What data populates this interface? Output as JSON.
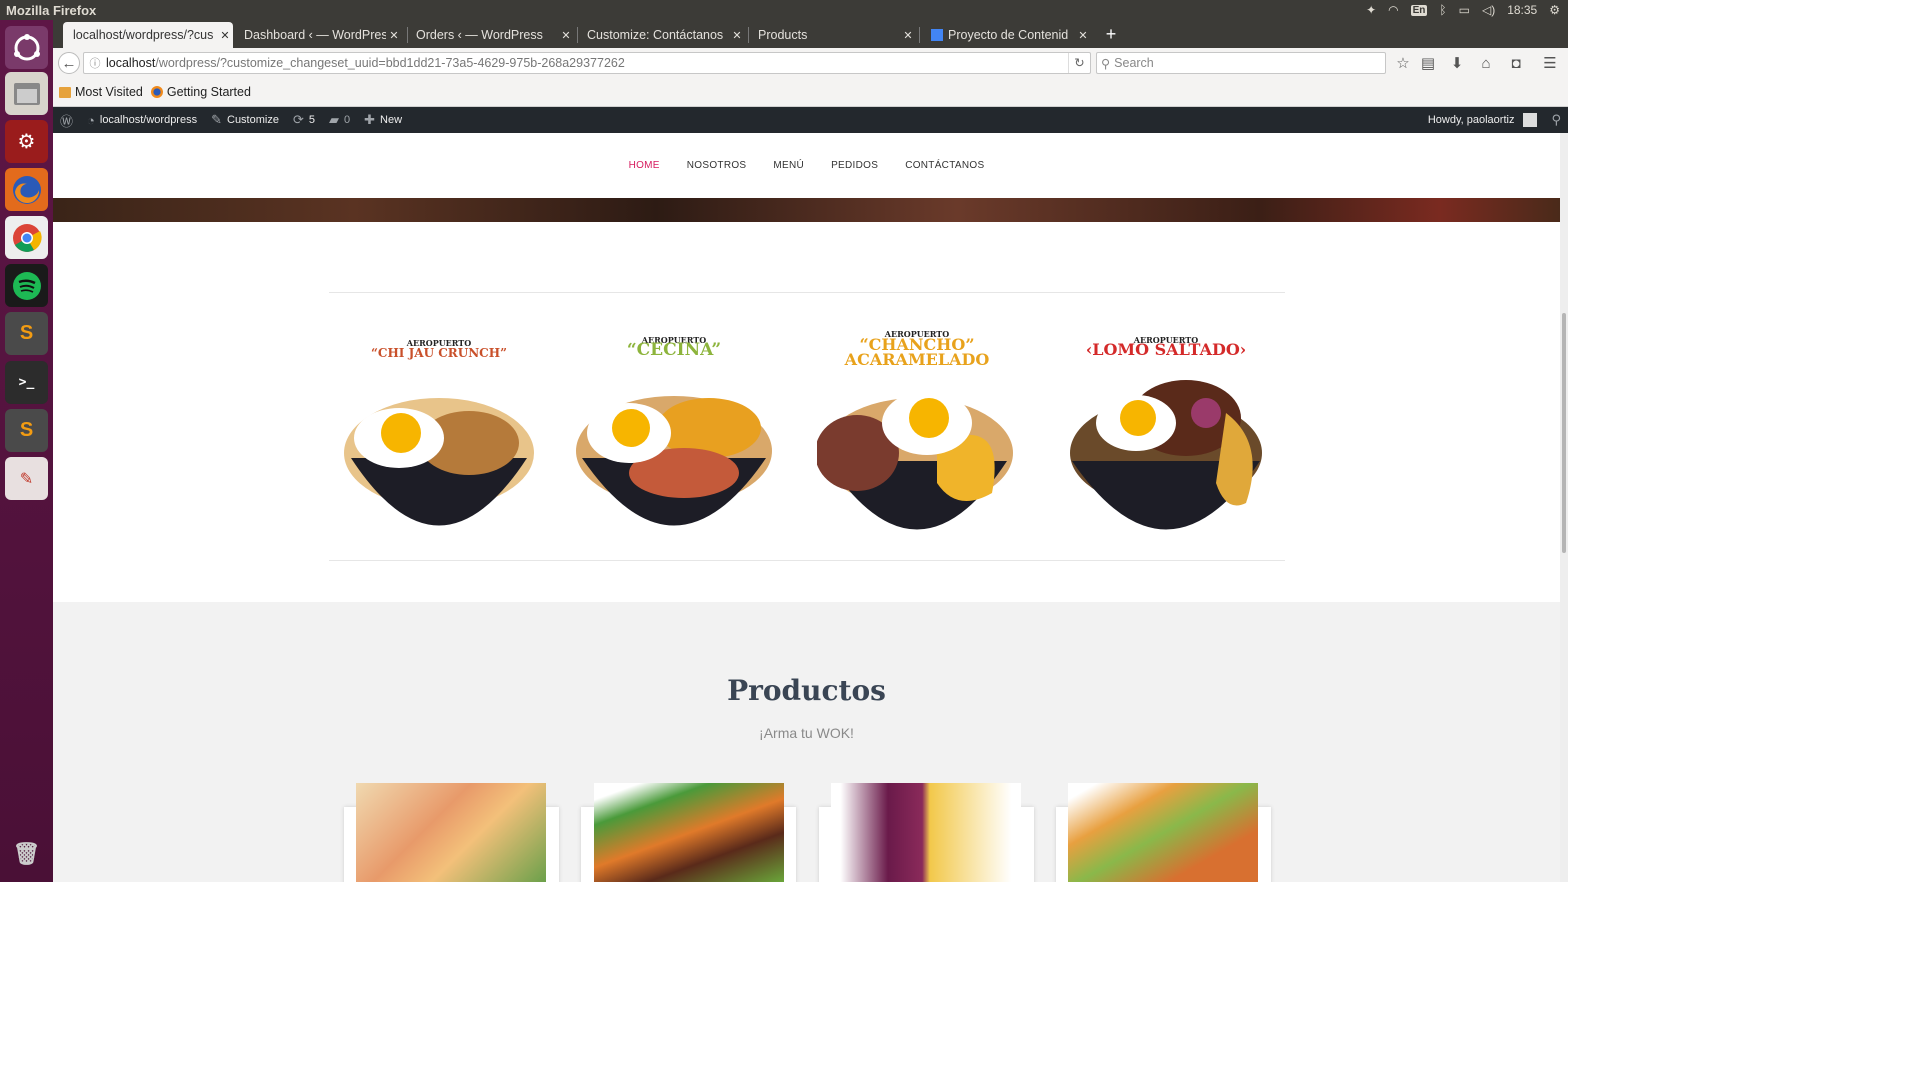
{
  "os": {
    "title": "Mozilla Firefox",
    "lang": "En",
    "clock": "18:35"
  },
  "tabs": [
    {
      "label": "localhost/wordpress/?cus",
      "active": true
    },
    {
      "label": "Dashboard ‹ — WordPres",
      "active": false
    },
    {
      "label": "Orders ‹ — WordPress",
      "active": false
    },
    {
      "label": "Customize: Contáctanos",
      "active": false
    },
    {
      "label": "Products",
      "active": false
    },
    {
      "label": "Proyecto de Contenid",
      "active": false
    }
  ],
  "address": {
    "host": "localhost",
    "path": "/wordpress/?customize_changeset_uuid=bbd1dd21-73a5-4629-975b-268a29377262"
  },
  "search": {
    "placeholder": "Search"
  },
  "bookmarks": [
    "Most Visited",
    "Getting Started"
  ],
  "wpbar": {
    "site": "localhost/wordpress",
    "customize": "Customize",
    "updates": "5",
    "comments": "0",
    "new": "New",
    "howdy": "Howdy, paolaortiz"
  },
  "sitenav": [
    "HOME",
    "NOSOTROS",
    "MENÚ",
    "PEDIDOS",
    "CONTÁCTANOS"
  ],
  "dishes": [
    {
      "small": "AEROPUERTO",
      "big1": "“CHI JAU CRUNCH”",
      "big2": "",
      "color": "#c9502a"
    },
    {
      "small": "AEROPUERTO",
      "big1": "“CECINA”",
      "big2": "",
      "color": "#8db43c"
    },
    {
      "small": "AEROPUERTO",
      "big1": "“CHANCHO”",
      "big2": "ACARAMELADO",
      "color": "#e8a21c"
    },
    {
      "small": "AEROPUERTO",
      "big1": "‹LOMO SALTADO›",
      "big2": "",
      "color": "#d42a2a"
    }
  ],
  "products": {
    "title": "Productos",
    "subtitle": "¡Arma tu WOK!"
  }
}
